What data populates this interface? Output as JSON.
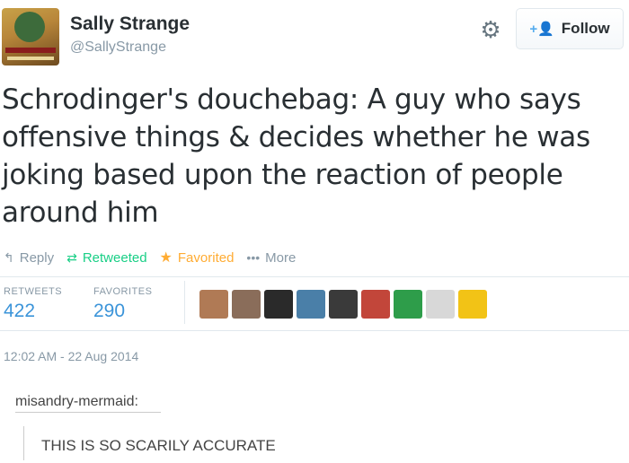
{
  "user": {
    "name": "Sally Strange",
    "handle": "@SallyStrange"
  },
  "follow_button": {
    "label": "Follow"
  },
  "tweet": {
    "text_lines": [
      "Schrodinger's douchebag: A guy who says",
      "offensive things & decides whether he was",
      "joking based upon the reaction of people",
      "around him"
    ]
  },
  "actions": {
    "reply": "Reply",
    "retweeted": "Retweeted",
    "favorited": "Favorited",
    "more": "More"
  },
  "stats": {
    "retweets_label": "RETWEETS",
    "retweets_value": "422",
    "favorites_label": "FAVORITES",
    "favorites_value": "290"
  },
  "favoriters": [
    {
      "icon": "favoriter-avatar",
      "color": "#b07a55"
    },
    {
      "icon": "favoriter-avatar",
      "color": "#8a6d5a"
    },
    {
      "icon": "favoriter-avatar",
      "color": "#2a2a2a"
    },
    {
      "icon": "favoriter-avatar",
      "color": "#4a7fa8"
    },
    {
      "icon": "favoriter-avatar",
      "color": "#3a3a3a"
    },
    {
      "icon": "favoriter-avatar",
      "color": "#c2463a"
    },
    {
      "icon": "favoriter-avatar",
      "color": "#2e9d4a"
    },
    {
      "icon": "favoriter-avatar",
      "color": "#d8d8d8"
    },
    {
      "icon": "favoriter-avatar",
      "color": "#f2c316"
    }
  ],
  "timestamp": "12:02 AM - 22 Aug 2014",
  "reblog": {
    "username": "misandry-mermaid:",
    "comment": "THIS IS SO SCARILY ACCURATE"
  },
  "colors": {
    "accent": "#3b94d9",
    "retweeted": "#19cf86",
    "favorited": "#ffac33",
    "muted": "#8899a6"
  }
}
